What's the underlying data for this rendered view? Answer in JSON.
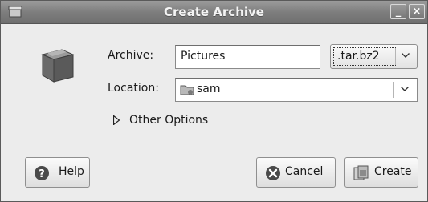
{
  "window": {
    "title": "Create Archive",
    "minimize_glyph": "_",
    "close_glyph": "×"
  },
  "form": {
    "archive_label": "Archive:",
    "archive_value": "Pictures",
    "extension_value": ".tar.bz2",
    "location_label": "Location:",
    "location_value": "sam",
    "other_options_label": "Other Options"
  },
  "buttons": {
    "help": "Help",
    "cancel": "Cancel",
    "create": "Create"
  },
  "icons": {
    "window": "archive-window-icon",
    "archive": "archive-box-icon",
    "folder": "home-folder-icon",
    "help": "help-icon",
    "cancel": "cancel-icon",
    "create": "create-icon"
  },
  "colors": {
    "titlebar": "#7e7e7e",
    "dialog_bg": "#ececec",
    "icon_gray": "#5c5c5c"
  }
}
